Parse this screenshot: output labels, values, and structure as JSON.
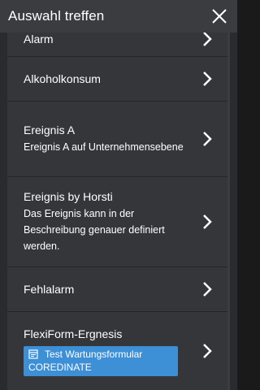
{
  "header": {
    "title": "Auswahl treffen",
    "close_icon": "close-icon"
  },
  "items": [
    {
      "title": "Alarm"
    },
    {
      "title": "Alkoholkonsum"
    },
    {
      "title": "Ereignis A",
      "description": "Ereignis A auf Unternehmensebene"
    },
    {
      "title": "Ereignis by Horsti",
      "description": "Das Ereignis kann in der Beschreibung genauer definiert werden."
    },
    {
      "title": "Fehlalarm"
    },
    {
      "title": "FlexiForm-Ergnesis",
      "tag": {
        "line1": "Test Wartungsformular",
        "line2": "COREDINATE",
        "icon": "form-icon"
      }
    }
  ],
  "colors": {
    "background": "#3a3c40",
    "divider": "#24252a",
    "tag": "#3d8fd6"
  }
}
